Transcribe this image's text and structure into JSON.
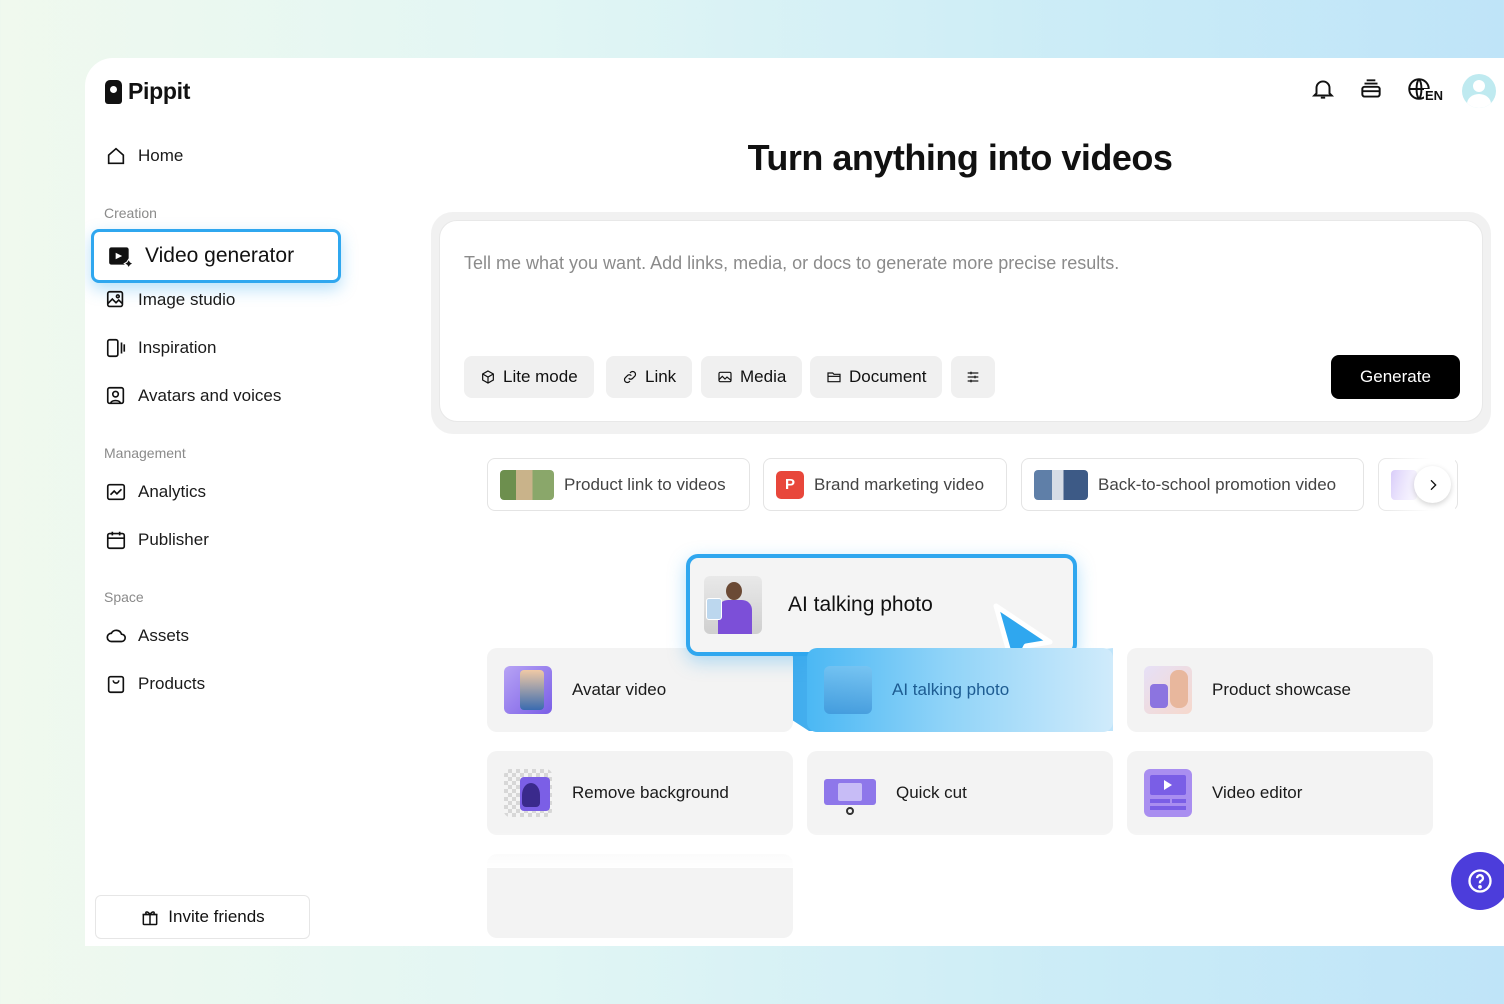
{
  "brand": {
    "name": "Pippit"
  },
  "header": {
    "language": "EN"
  },
  "sidebar": {
    "home": "Home",
    "sections": {
      "creation": "Creation",
      "management": "Management",
      "space": "Space"
    },
    "creation_items": [
      "Video generator",
      "Image studio",
      "Inspiration",
      "Avatars and voices"
    ],
    "management_items": [
      "Analytics",
      "Publisher"
    ],
    "space_items": [
      "Assets",
      "Products"
    ],
    "active_item": "Video generator",
    "invite": "Invite friends"
  },
  "main": {
    "title": "Turn anything into videos",
    "prompt": {
      "placeholder": "Tell me what you want. Add links, media, or docs to generate more precise results.",
      "chips": [
        "Lite mode",
        "Link",
        "Media",
        "Document"
      ],
      "generate": "Generate"
    },
    "suggestions": [
      "Product link to videos",
      "Brand marketing video",
      "Back-to-school promotion video"
    ],
    "suggestion_badge": "P",
    "tools": [
      "Avatar video",
      "AI talking photo",
      "Product showcase",
      "Remove background",
      "Quick cut",
      "Video editor"
    ],
    "popup": "AI talking photo"
  },
  "colors": {
    "accent_blue": "#2fa7ef",
    "help_button": "#4c3ddb",
    "generate_button": "#000000",
    "brand_badge": "#e8473b"
  },
  "icons": {
    "nav": [
      "home-icon",
      "video-generator-icon",
      "image-studio-icon",
      "inspiration-icon",
      "avatars-icon",
      "analytics-icon",
      "publisher-icon",
      "assets-icon",
      "products-icon"
    ],
    "header": [
      "bell-icon",
      "layers-icon",
      "globe-icon",
      "avatar"
    ],
    "help": "question-icon"
  }
}
